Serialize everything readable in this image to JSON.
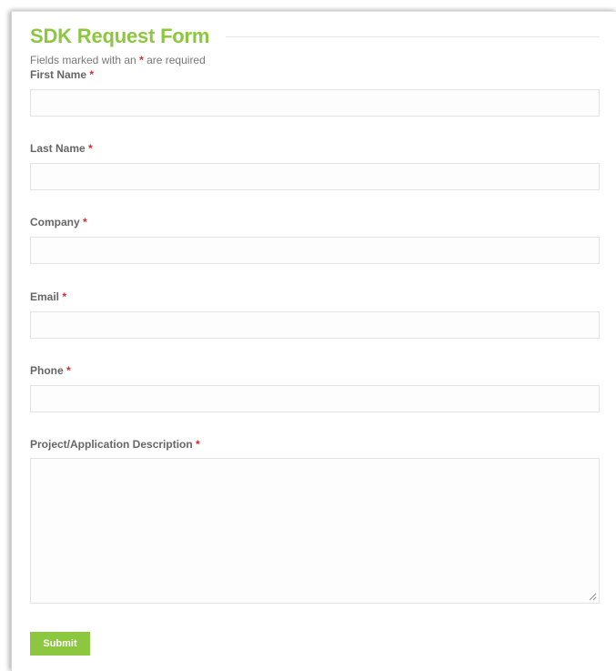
{
  "form": {
    "title": "SDK Request Form",
    "required_note_prefix": "Fields marked with an",
    "required_marker": "*",
    "required_note_suffix": "are required",
    "fields": [
      {
        "label": "First Name",
        "value": ""
      },
      {
        "label": "Last Name",
        "value": ""
      },
      {
        "label": "Company",
        "value": ""
      },
      {
        "label": "Email",
        "value": ""
      },
      {
        "label": "Phone",
        "value": ""
      },
      {
        "label": "Project/Application Description",
        "value": ""
      }
    ],
    "submit_label": "Submit"
  },
  "colors": {
    "accent": "#8dc63f",
    "required": "#e0282b",
    "label": "#666666",
    "input_border": "#e3e3e3"
  }
}
